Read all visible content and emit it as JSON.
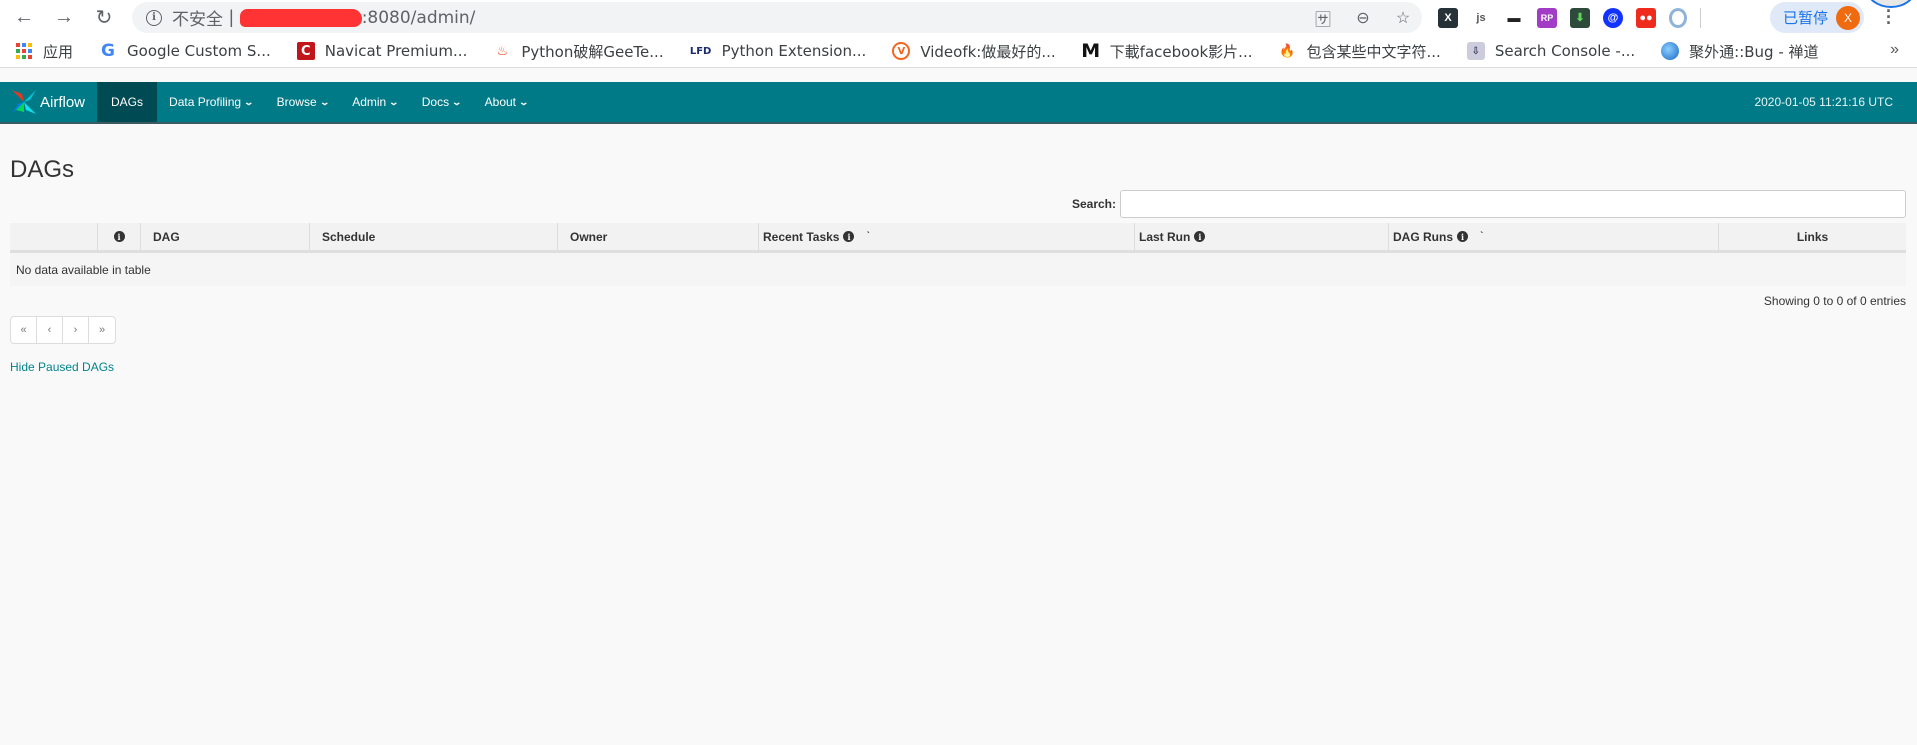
{
  "browser": {
    "url_insecure_label": "不安全",
    "url_suffix": ":8080/admin/",
    "paused_label": "已暂停",
    "avatar_letter": "X",
    "bookmarks": [
      {
        "icon": "apps-grid-icon",
        "label": "应用"
      },
      {
        "icon": "google-icon",
        "label": "Google Custom S..."
      },
      {
        "icon": "navicat-icon",
        "label": "Navicat Premium..."
      },
      {
        "icon": "flame-icon",
        "label": "Python破解GeeTe..."
      },
      {
        "icon": "lfd-icon",
        "label": "Python Extension..."
      },
      {
        "icon": "videofk-icon",
        "label": "Videofk:做最好的..."
      },
      {
        "icon": "m-logo-icon",
        "label": "下載facebook影片..."
      },
      {
        "icon": "fire-icon",
        "label": "包含某些中文字符..."
      },
      {
        "icon": "search-console-icon",
        "label": "Search Console -..."
      },
      {
        "icon": "globe-icon",
        "label": "聚外通::Bug - 禅道"
      }
    ],
    "bookmarks_overflow": "»"
  },
  "navbar": {
    "brand": "Airflow",
    "items": [
      {
        "label": "DAGs",
        "active": true,
        "dropdown": false
      },
      {
        "label": "Data Profiling",
        "active": false,
        "dropdown": true
      },
      {
        "label": "Browse",
        "active": false,
        "dropdown": true
      },
      {
        "label": "Admin",
        "active": false,
        "dropdown": true
      },
      {
        "label": "Docs",
        "active": false,
        "dropdown": true
      },
      {
        "label": "About",
        "active": false,
        "dropdown": true
      }
    ],
    "datetime": "2020-01-05 11:21:16 UTC",
    "colors": {
      "bar": "#007a87",
      "active": "#004a54"
    }
  },
  "main": {
    "title": "DAGs",
    "search": {
      "label": "Search:",
      "value": "",
      "placeholder": ""
    },
    "table": {
      "columns": [
        {
          "label": "",
          "info": false,
          "sort": false
        },
        {
          "label": "",
          "info": true,
          "sort": false
        },
        {
          "label": "DAG",
          "info": false,
          "sort": false
        },
        {
          "label": "Schedule",
          "info": false,
          "sort": false
        },
        {
          "label": "Owner",
          "info": false,
          "sort": false
        },
        {
          "label": "Recent Tasks",
          "info": true,
          "sort": true
        },
        {
          "label": "Last Run",
          "info": true,
          "sort": false
        },
        {
          "label": "DAG Runs",
          "info": true,
          "sort": true
        },
        {
          "label": "Links",
          "info": false,
          "sort": false
        }
      ],
      "empty_message": "No data available in table",
      "rows": []
    },
    "info_text": "Showing 0 to 0 of 0 entries",
    "pagination": {
      "first": "«",
      "prev": "‹",
      "next": "›",
      "last": "»"
    },
    "hide_paused_link": "Hide Paused DAGs"
  }
}
